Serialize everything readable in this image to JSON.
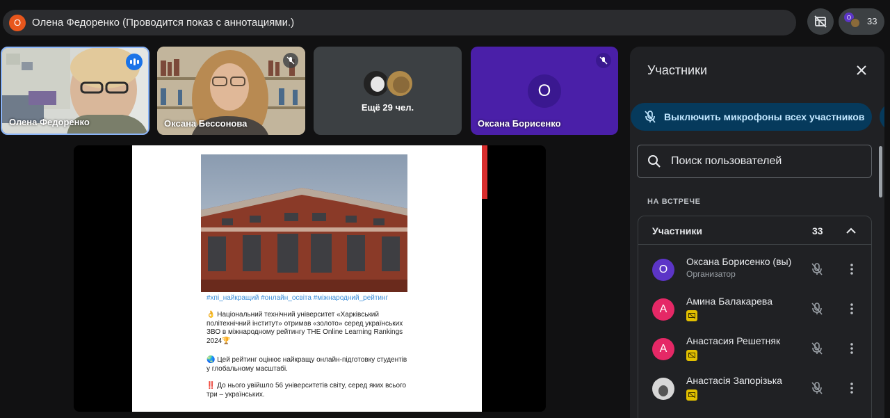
{
  "top_bar": {
    "presenter_initial": "О",
    "presenting_text": "Олена Федоренко (Проводится показ с аннотациями.)",
    "participant_count": "33"
  },
  "tiles": [
    {
      "name": "Олена Федоренко"
    },
    {
      "name": "Оксана Бессонова"
    },
    {
      "name": "Ещё 29 чел."
    },
    {
      "name": "Оксана Борисенко",
      "initial": "О"
    }
  ],
  "slide": {
    "hashtags": "#хпі_найкращий #онлайн_освіта #міжнародний_рейтинг",
    "paragraph1": "👌 Національний технічний університет «Харківський політехнічний інститут» отримав «золото»  серед українських ЗВО в міжнародному рейтингу THE Online Learning Rankings 2024🏆",
    "paragraph2": "🌏 Цей рейтинг  оцінює найкращу онлайн-підготовку студентів у глобальному масштабі.",
    "paragraph3": "‼️ До нього увійшло 56 університетів світу, серед яких всього три – українських."
  },
  "panel": {
    "title": "Участники",
    "mute_all_label": "Выключить микрофоны всех участников",
    "search_placeholder": "Поиск пользователей",
    "section_label": "НА ВСТРЕЧЕ",
    "group_title": "Участники",
    "group_count": "33",
    "participants": [
      {
        "initial": "О",
        "name": "Оксана Борисенко (вы)",
        "role": "Организатор",
        "color": "#5c35c7"
      },
      {
        "initial": "А",
        "name": "Амина Балакарева",
        "color": "#e52866"
      },
      {
        "initial": "А",
        "name": "Анастасия Решетняк",
        "color": "#e52866"
      },
      {
        "initial": "",
        "name": "Анастасія Запорізька",
        "color": "#d7d7d7"
      }
    ]
  },
  "colors": {
    "accent": "#063a5c",
    "accent_text": "#c2e7ff",
    "presenter": "#e8561c"
  }
}
